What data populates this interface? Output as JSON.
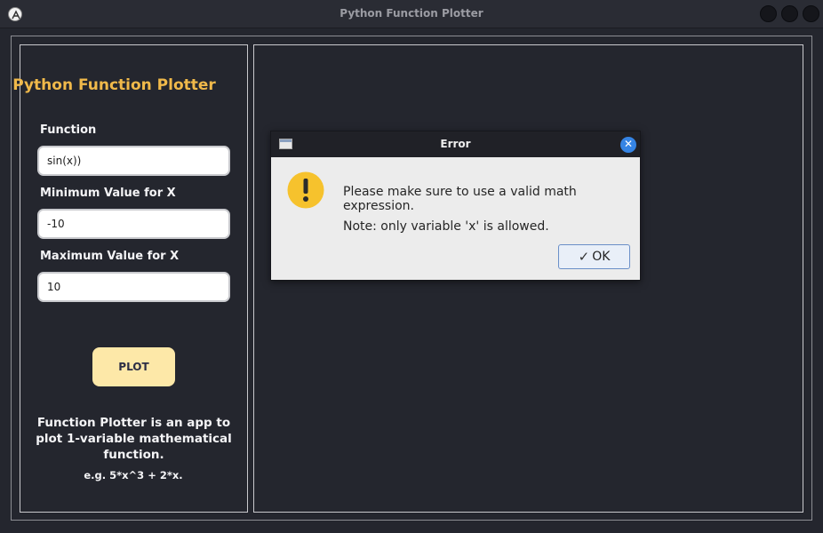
{
  "window": {
    "title": "Python Function Plotter",
    "app_icon": "app-logo-icon",
    "controls": [
      "minimize-button",
      "maximize-button",
      "close-button"
    ]
  },
  "sidebar": {
    "title": "Python Function Plotter",
    "function_label": "Function",
    "function_value": "sin(x))",
    "min_label": "Minimum Value for X",
    "min_value": "-10",
    "max_label": "Maximum Value for X",
    "max_value": "10",
    "plot_button": "PLOT",
    "description": "Function Plotter is an app to plot 1-variable mathematical function.",
    "example": "e.g.  5*x^3 + 2*x."
  },
  "dialog": {
    "title": "Error",
    "message": "Please make sure to use a valid math expression.",
    "note": "Note: only variable 'x' is allowed.",
    "ok_label": "OK",
    "icon": "warning-icon"
  },
  "colors": {
    "background": "#24262e",
    "accent_title": "#f0b94a",
    "plot_button": "#fde8a8",
    "dialog_close": "#3584e4",
    "warning": "#f6c22d"
  }
}
